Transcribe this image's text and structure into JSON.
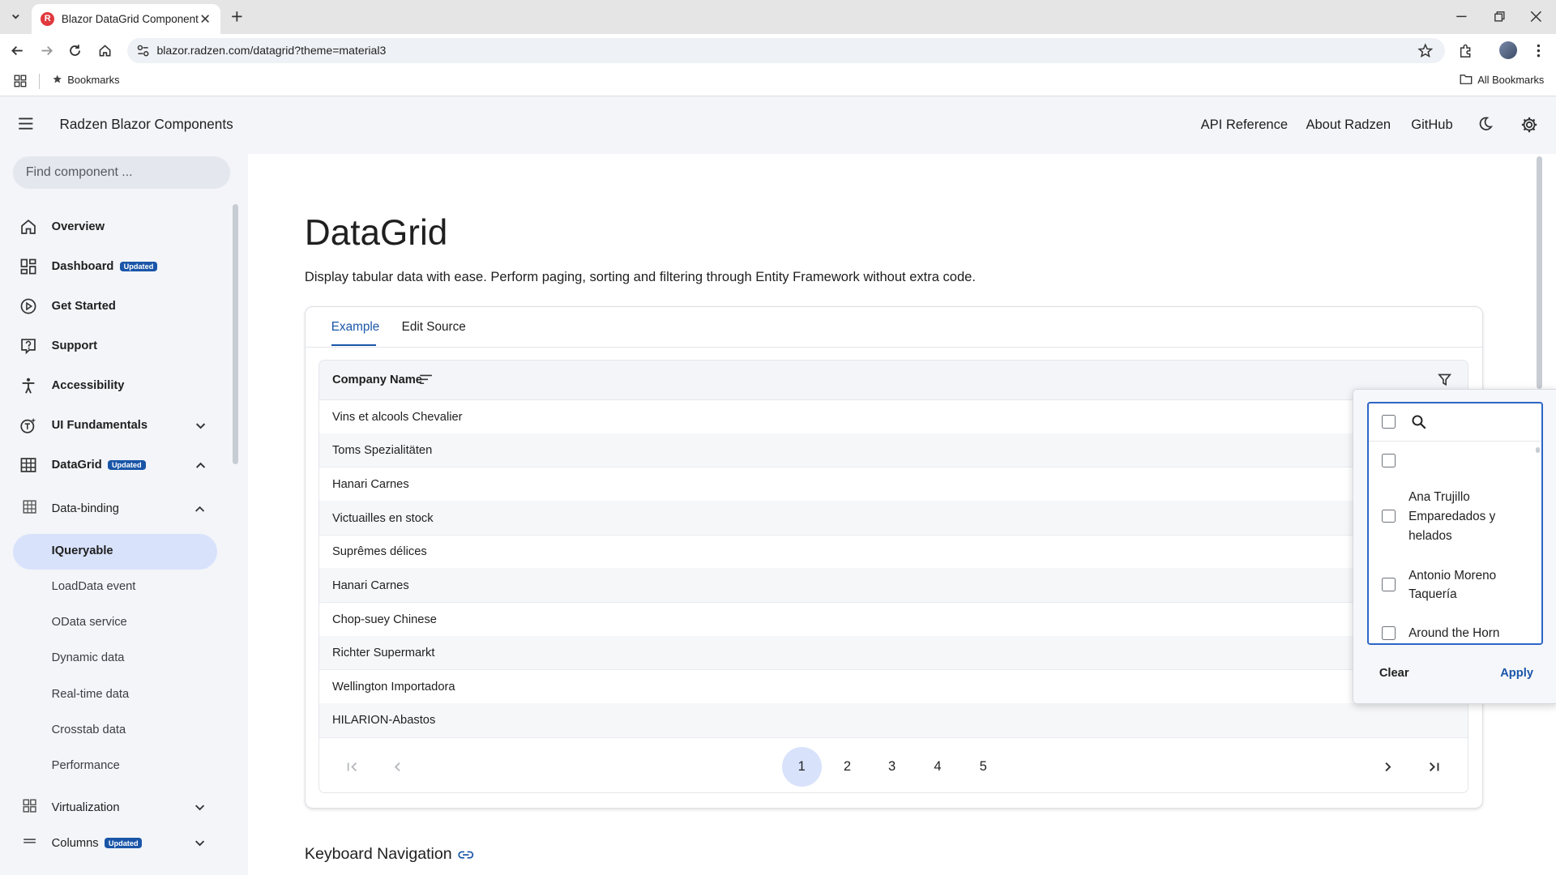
{
  "browser": {
    "tab_title": "Blazor DataGrid Component wi",
    "url": "blazor.radzen.com/datagrid?theme=material3",
    "bookmarks_label": "Bookmarks",
    "all_bookmarks_label": "All Bookmarks"
  },
  "header": {
    "app_title": "Radzen Blazor Components",
    "links": [
      "API Reference",
      "About Radzen",
      "GitHub"
    ]
  },
  "sidebar": {
    "search_placeholder": "Find component ...",
    "items": [
      {
        "label": "Overview",
        "icon": "home-icon"
      },
      {
        "label": "Dashboard",
        "badge": "Updated",
        "icon": "dashboard-icon"
      },
      {
        "label": "Get Started",
        "icon": "play-circle-icon"
      },
      {
        "label": "Support",
        "icon": "help-box-icon"
      },
      {
        "label": "Accessibility",
        "icon": "accessibility-icon"
      },
      {
        "label": "UI Fundamentals",
        "icon": "ui-fundamentals-icon"
      },
      {
        "label": "DataGrid",
        "badge": "Updated",
        "icon": "table-icon"
      }
    ],
    "data_binding": {
      "label": "Data-binding",
      "children": [
        "IQueryable",
        "LoadData event",
        "OData service",
        "Dynamic data",
        "Real-time data",
        "Crosstab data",
        "Performance"
      ],
      "active": "IQueryable"
    },
    "virtualization_label": "Virtualization",
    "columns_label": "Columns",
    "columns_badge": "Updated"
  },
  "main": {
    "title": "DataGrid",
    "description": "Display tabular data with ease. Perform paging, sorting and filtering through Entity Framework without extra code.",
    "tabs": [
      "Example",
      "Edit Source"
    ],
    "active_tab": "Example",
    "grid": {
      "column_header": "Company Name",
      "rows": [
        "Vins et alcools Chevalier",
        "Toms Spezialitäten",
        "Hanari Carnes",
        "Victuailles en stock",
        "Suprêmes délices",
        "Hanari Carnes",
        "Chop-suey Chinese",
        "Richter Supermarkt",
        "Wellington Importadora",
        "HILARION-Abastos"
      ],
      "pages": [
        "1",
        "2",
        "3",
        "4",
        "5"
      ],
      "current_page": "1"
    },
    "keyboard_section_title": "Keyboard Navigation"
  },
  "filter_popup": {
    "options": [
      "",
      "Ana Trujillo Emparedados y helados",
      "Antonio Moreno Taquería",
      "Around the Horn"
    ],
    "clear_label": "Clear",
    "apply_label": "Apply"
  },
  "colors": {
    "accent": "#1a56a8",
    "active_bg": "#d8e2fb",
    "sidebar_bg": "#f3f5f9"
  }
}
